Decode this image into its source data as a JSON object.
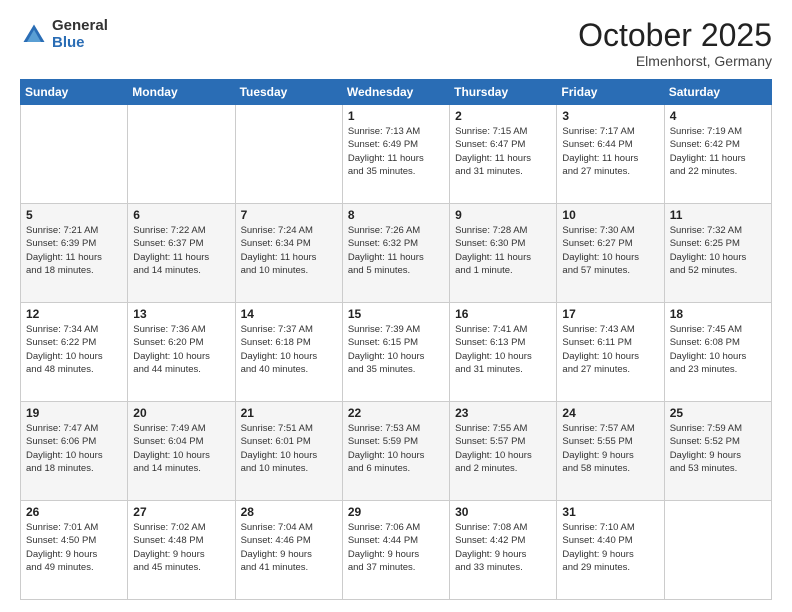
{
  "header": {
    "logo_general": "General",
    "logo_blue": "Blue",
    "title": "October 2025",
    "location": "Elmenhorst, Germany"
  },
  "weekdays": [
    "Sunday",
    "Monday",
    "Tuesday",
    "Wednesday",
    "Thursday",
    "Friday",
    "Saturday"
  ],
  "weeks": [
    [
      {
        "day": "",
        "info": ""
      },
      {
        "day": "",
        "info": ""
      },
      {
        "day": "",
        "info": ""
      },
      {
        "day": "1",
        "info": "Sunrise: 7:13 AM\nSunset: 6:49 PM\nDaylight: 11 hours\nand 35 minutes."
      },
      {
        "day": "2",
        "info": "Sunrise: 7:15 AM\nSunset: 6:47 PM\nDaylight: 11 hours\nand 31 minutes."
      },
      {
        "day": "3",
        "info": "Sunrise: 7:17 AM\nSunset: 6:44 PM\nDaylight: 11 hours\nand 27 minutes."
      },
      {
        "day": "4",
        "info": "Sunrise: 7:19 AM\nSunset: 6:42 PM\nDaylight: 11 hours\nand 22 minutes."
      }
    ],
    [
      {
        "day": "5",
        "info": "Sunrise: 7:21 AM\nSunset: 6:39 PM\nDaylight: 11 hours\nand 18 minutes."
      },
      {
        "day": "6",
        "info": "Sunrise: 7:22 AM\nSunset: 6:37 PM\nDaylight: 11 hours\nand 14 minutes."
      },
      {
        "day": "7",
        "info": "Sunrise: 7:24 AM\nSunset: 6:34 PM\nDaylight: 11 hours\nand 10 minutes."
      },
      {
        "day": "8",
        "info": "Sunrise: 7:26 AM\nSunset: 6:32 PM\nDaylight: 11 hours\nand 5 minutes."
      },
      {
        "day": "9",
        "info": "Sunrise: 7:28 AM\nSunset: 6:30 PM\nDaylight: 11 hours\nand 1 minute."
      },
      {
        "day": "10",
        "info": "Sunrise: 7:30 AM\nSunset: 6:27 PM\nDaylight: 10 hours\nand 57 minutes."
      },
      {
        "day": "11",
        "info": "Sunrise: 7:32 AM\nSunset: 6:25 PM\nDaylight: 10 hours\nand 52 minutes."
      }
    ],
    [
      {
        "day": "12",
        "info": "Sunrise: 7:34 AM\nSunset: 6:22 PM\nDaylight: 10 hours\nand 48 minutes."
      },
      {
        "day": "13",
        "info": "Sunrise: 7:36 AM\nSunset: 6:20 PM\nDaylight: 10 hours\nand 44 minutes."
      },
      {
        "day": "14",
        "info": "Sunrise: 7:37 AM\nSunset: 6:18 PM\nDaylight: 10 hours\nand 40 minutes."
      },
      {
        "day": "15",
        "info": "Sunrise: 7:39 AM\nSunset: 6:15 PM\nDaylight: 10 hours\nand 35 minutes."
      },
      {
        "day": "16",
        "info": "Sunrise: 7:41 AM\nSunset: 6:13 PM\nDaylight: 10 hours\nand 31 minutes."
      },
      {
        "day": "17",
        "info": "Sunrise: 7:43 AM\nSunset: 6:11 PM\nDaylight: 10 hours\nand 27 minutes."
      },
      {
        "day": "18",
        "info": "Sunrise: 7:45 AM\nSunset: 6:08 PM\nDaylight: 10 hours\nand 23 minutes."
      }
    ],
    [
      {
        "day": "19",
        "info": "Sunrise: 7:47 AM\nSunset: 6:06 PM\nDaylight: 10 hours\nand 18 minutes."
      },
      {
        "day": "20",
        "info": "Sunrise: 7:49 AM\nSunset: 6:04 PM\nDaylight: 10 hours\nand 14 minutes."
      },
      {
        "day": "21",
        "info": "Sunrise: 7:51 AM\nSunset: 6:01 PM\nDaylight: 10 hours\nand 10 minutes."
      },
      {
        "day": "22",
        "info": "Sunrise: 7:53 AM\nSunset: 5:59 PM\nDaylight: 10 hours\nand 6 minutes."
      },
      {
        "day": "23",
        "info": "Sunrise: 7:55 AM\nSunset: 5:57 PM\nDaylight: 10 hours\nand 2 minutes."
      },
      {
        "day": "24",
        "info": "Sunrise: 7:57 AM\nSunset: 5:55 PM\nDaylight: 9 hours\nand 58 minutes."
      },
      {
        "day": "25",
        "info": "Sunrise: 7:59 AM\nSunset: 5:52 PM\nDaylight: 9 hours\nand 53 minutes."
      }
    ],
    [
      {
        "day": "26",
        "info": "Sunrise: 7:01 AM\nSunset: 4:50 PM\nDaylight: 9 hours\nand 49 minutes."
      },
      {
        "day": "27",
        "info": "Sunrise: 7:02 AM\nSunset: 4:48 PM\nDaylight: 9 hours\nand 45 minutes."
      },
      {
        "day": "28",
        "info": "Sunrise: 7:04 AM\nSunset: 4:46 PM\nDaylight: 9 hours\nand 41 minutes."
      },
      {
        "day": "29",
        "info": "Sunrise: 7:06 AM\nSunset: 4:44 PM\nDaylight: 9 hours\nand 37 minutes."
      },
      {
        "day": "30",
        "info": "Sunrise: 7:08 AM\nSunset: 4:42 PM\nDaylight: 9 hours\nand 33 minutes."
      },
      {
        "day": "31",
        "info": "Sunrise: 7:10 AM\nSunset: 4:40 PM\nDaylight: 9 hours\nand 29 minutes."
      },
      {
        "day": "",
        "info": ""
      }
    ]
  ]
}
